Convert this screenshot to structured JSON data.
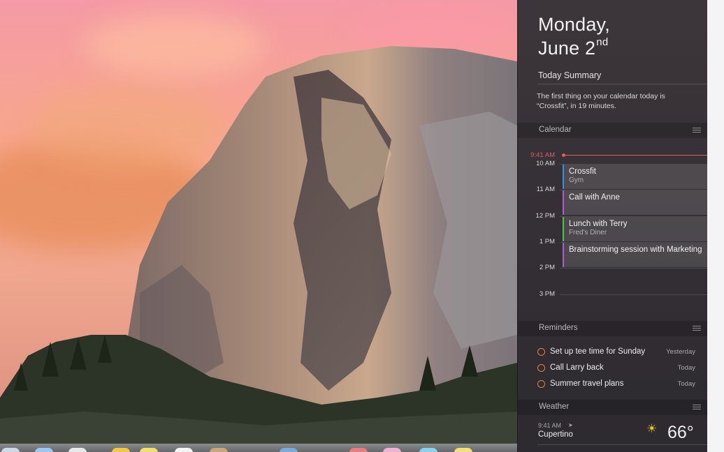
{
  "notification_center": {
    "date": {
      "weekday": "Monday,",
      "month_day": "June 2",
      "ordinal": "nd"
    },
    "today_summary": {
      "title": "Today Summary",
      "text": "The first thing on your calendar today is “Crossfit”, in 19 minutes."
    },
    "calendar": {
      "title": "Calendar",
      "current_time": "9:41 AM",
      "hours": [
        "10 AM",
        "11 AM",
        "12 PM",
        "1 PM",
        "2 PM",
        "3 PM"
      ],
      "events": [
        {
          "name": "Crossfit",
          "location": "Gym",
          "color": "#3b8de0"
        },
        {
          "name": "Call with Anne",
          "location": "",
          "color": "#b05ad4"
        },
        {
          "name": "Lunch with Terry",
          "location": "Fred's Diner",
          "color": "#4fc34a"
        },
        {
          "name": "Brainstorming session with Marketing",
          "location": "",
          "color": "#b05ad4"
        }
      ]
    },
    "reminders": {
      "title": "Reminders",
      "items": [
        {
          "text": "Set up tee time for Sunday",
          "when": "Yesterday"
        },
        {
          "text": "Call Larry back",
          "when": "Today"
        },
        {
          "text": "Summer travel plans",
          "when": "Today"
        }
      ]
    },
    "weather": {
      "title": "Weather",
      "time": "9:41 AM",
      "location_icon": "location-arrow-icon",
      "city": "Cupertino",
      "condition_icon": "sun-icon",
      "temperature": "66°"
    }
  },
  "colors": {
    "now_indicator": "#e45a62",
    "reminder_circle": "#e1813d",
    "sun": "#f3c32b"
  }
}
